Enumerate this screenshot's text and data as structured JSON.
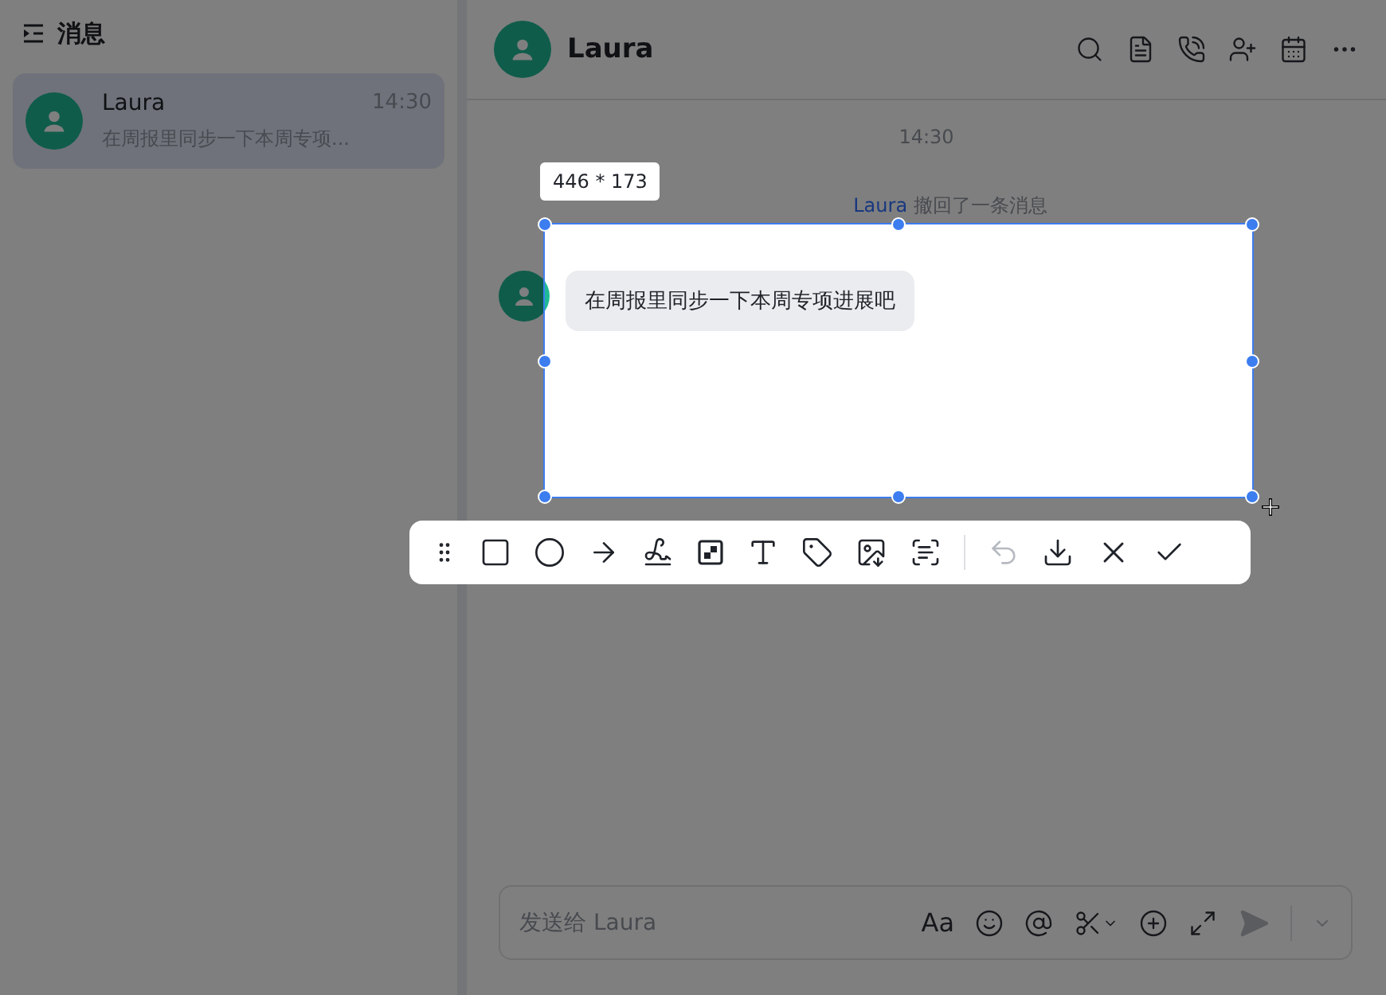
{
  "sidebar": {
    "title": "消息",
    "conversations": [
      {
        "name": "Laura",
        "time": "14:30",
        "preview": "在周报里同步一下本周专项...",
        "selected": true
      }
    ]
  },
  "chat": {
    "name": "Laura",
    "time_divider": "14:30",
    "recall_notice": {
      "name": "Laura",
      "text": "撤回了一条消息"
    },
    "messages": [
      {
        "text": "在周报里同步一下本周专项进展吧"
      }
    ],
    "input": {
      "placeholder": "发送给 Laura",
      "format_label": "Aa"
    }
  },
  "screenshot": {
    "size_label": "446 * 173",
    "toolbar": {
      "undo_disabled": true
    }
  }
}
